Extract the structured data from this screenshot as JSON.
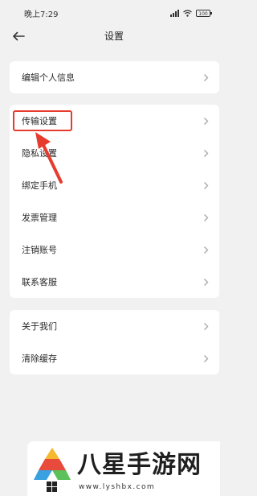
{
  "status": {
    "time": "晚上7:29",
    "battery": "100"
  },
  "header": {
    "title": "设置"
  },
  "sections": [
    {
      "items": [
        {
          "label": "编辑个人信息"
        }
      ]
    },
    {
      "items": [
        {
          "label": "传输设置"
        },
        {
          "label": "隐私设置"
        },
        {
          "label": "绑定手机"
        },
        {
          "label": "发票管理"
        },
        {
          "label": "注销账号"
        },
        {
          "label": "联系客服"
        }
      ]
    },
    {
      "items": [
        {
          "label": "关于我们"
        },
        {
          "label": "清除缓存"
        }
      ]
    }
  ],
  "annotation": {
    "color": "#e63c2e"
  },
  "watermark": {
    "brand": "八星手游网",
    "url": "www.lyshbx.com"
  },
  "icons": [
    "signal-icon",
    "wifi-icon",
    "battery-icon",
    "back-arrow-icon",
    "chevron-right-icon"
  ]
}
